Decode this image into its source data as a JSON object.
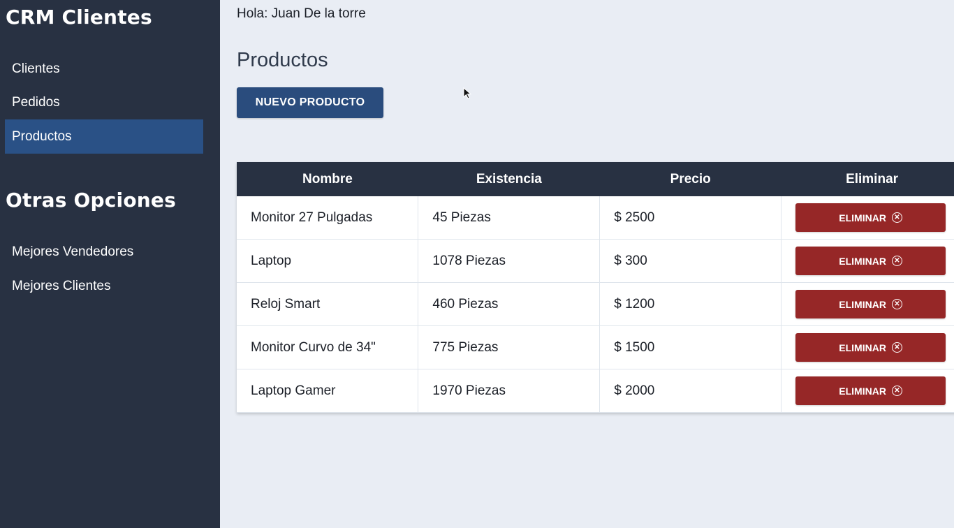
{
  "sidebar": {
    "brand": "CRM Clientes",
    "nav": [
      {
        "label": "Clientes"
      },
      {
        "label": "Pedidos"
      },
      {
        "label": "Productos"
      }
    ],
    "section_title": "Otras Opciones",
    "extra": [
      {
        "label": "Mejores Vendedores"
      },
      {
        "label": "Mejores Clientes"
      }
    ]
  },
  "header": {
    "greeting": "Hola: Juan De la torre"
  },
  "main": {
    "title": "Productos",
    "new_button": "NUEVO PRODUCTO",
    "table": {
      "headers": [
        "Nombre",
        "Existencia",
        "Precio",
        "Eliminar"
      ],
      "rows": [
        {
          "nombre": "Monitor 27 Pulgadas",
          "existencia": "45 Piezas",
          "precio": "$ 2500",
          "action": "ELIMINAR"
        },
        {
          "nombre": "Laptop",
          "existencia": "1078 Piezas",
          "precio": "$ 300",
          "action": "ELIMINAR"
        },
        {
          "nombre": "Reloj Smart",
          "existencia": "460 Piezas",
          "precio": "$ 1200",
          "action": "ELIMINAR"
        },
        {
          "nombre": "Monitor Curvo de 34\"",
          "existencia": "775 Piezas",
          "precio": "$ 1500",
          "action": "ELIMINAR"
        },
        {
          "nombre": "Laptop Gamer",
          "existencia": "1970 Piezas",
          "precio": "$ 2000",
          "action": "ELIMINAR"
        }
      ]
    }
  },
  "colors": {
    "sidebar_bg": "#283142",
    "active_nav": "#2a5186",
    "primary_button": "#2a4c7d",
    "danger_button": "#962727",
    "page_bg": "#e9edf4"
  },
  "icons": {
    "delete": "x-circle-icon",
    "cursor": "mouse-pointer-icon"
  }
}
